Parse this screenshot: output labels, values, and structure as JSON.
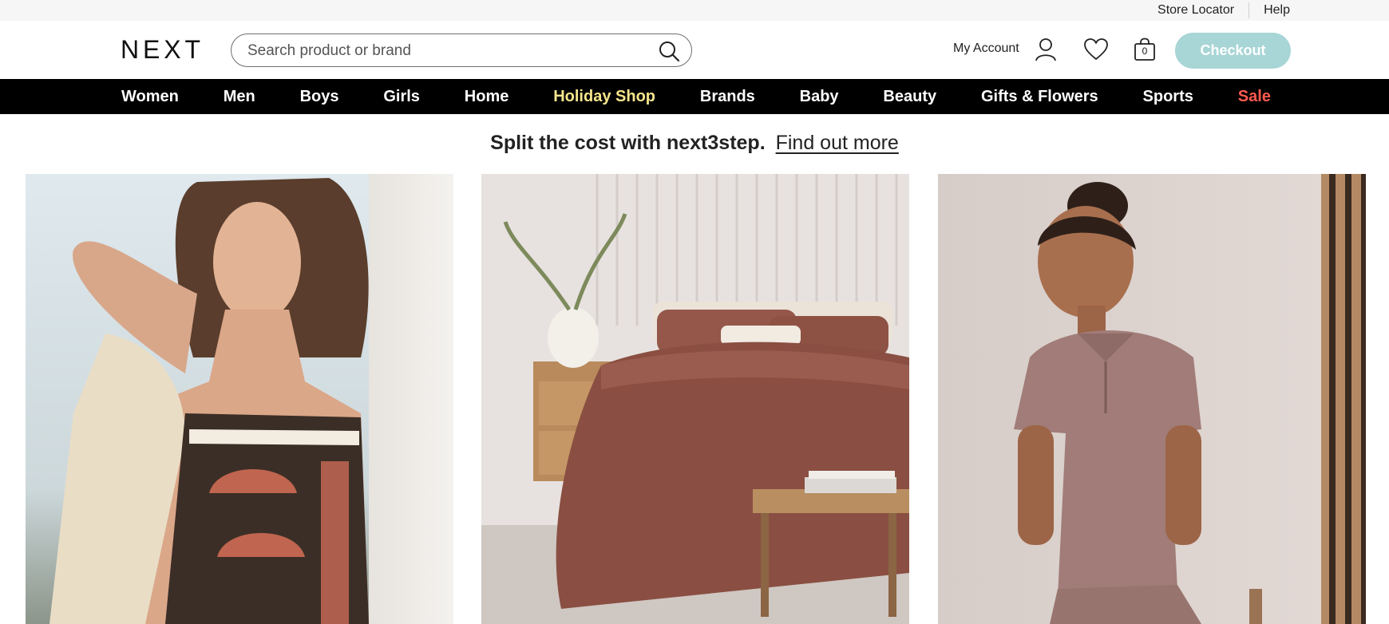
{
  "utility": {
    "store_locator": "Store Locator",
    "help": "Help"
  },
  "header": {
    "logo": "NEXT",
    "search": {
      "placeholder": "Search product or brand",
      "value": ""
    },
    "my_account": "My Account",
    "bag_count": "0",
    "checkout_label": "Checkout"
  },
  "icons": {
    "search": "search-icon",
    "account": "user-icon",
    "wishlist": "heart-icon",
    "bag": "shopping-bag-icon"
  },
  "nav": {
    "items": [
      {
        "label": "Women"
      },
      {
        "label": "Men"
      },
      {
        "label": "Boys"
      },
      {
        "label": "Girls"
      },
      {
        "label": "Home"
      },
      {
        "label": "Holiday Shop"
      },
      {
        "label": "Brands"
      },
      {
        "label": "Baby"
      },
      {
        "label": "Beauty"
      },
      {
        "label": "Gifts & Flowers"
      },
      {
        "label": "Sports"
      },
      {
        "label": "Sale"
      }
    ]
  },
  "promo": {
    "text": "Split the cost with next3step.",
    "link": "Find out more"
  },
  "tiles": [
    {
      "image": "woman-swimsuit-photo"
    },
    {
      "image": "brown-bedding-photo"
    },
    {
      "image": "boy-polo-photo"
    }
  ],
  "colors": {
    "nav_background": "#000000",
    "nav_text": "#ffffff",
    "holiday_highlight": "#f6e58d",
    "sale_red": "#ff5a4f",
    "checkout_button": "#a8d5d6",
    "utility_bar": "#f6f6f6"
  }
}
